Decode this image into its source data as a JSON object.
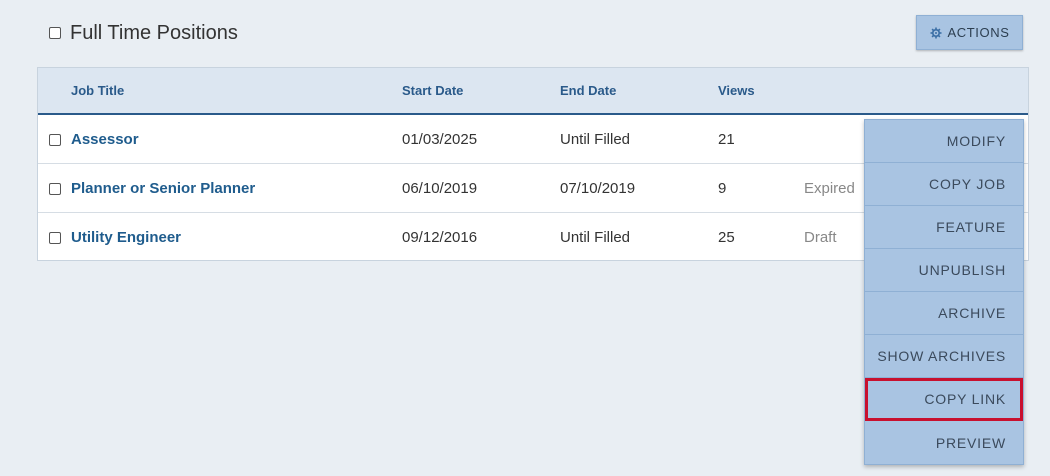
{
  "header": {
    "title": "Full Time Positions",
    "actions_label": "ACTIONS"
  },
  "table": {
    "columns": [
      "Job Title",
      "Start Date",
      "End Date",
      "Views"
    ],
    "rows": [
      {
        "title": "Assessor",
        "start": "01/03/2025",
        "end": "Until Filled",
        "views": "21",
        "status": ""
      },
      {
        "title": "Planner or Senior Planner",
        "start": "06/10/2019",
        "end": "07/10/2019",
        "views": "9",
        "status": "Expired"
      },
      {
        "title": "Utility Engineer",
        "start": "09/12/2016",
        "end": "Until Filled",
        "views": "25",
        "status": "Draft"
      }
    ]
  },
  "menu": {
    "items": [
      "MODIFY",
      "COPY JOB",
      "FEATURE",
      "UNPUBLISH",
      "ARCHIVE",
      "SHOW ARCHIVES",
      "COPY LINK",
      "PREVIEW"
    ],
    "highlighted": "COPY LINK"
  },
  "colors": {
    "accent": "#1f5c8d",
    "menu_bg": "#a9c4e2",
    "highlight": "#c8102e"
  }
}
